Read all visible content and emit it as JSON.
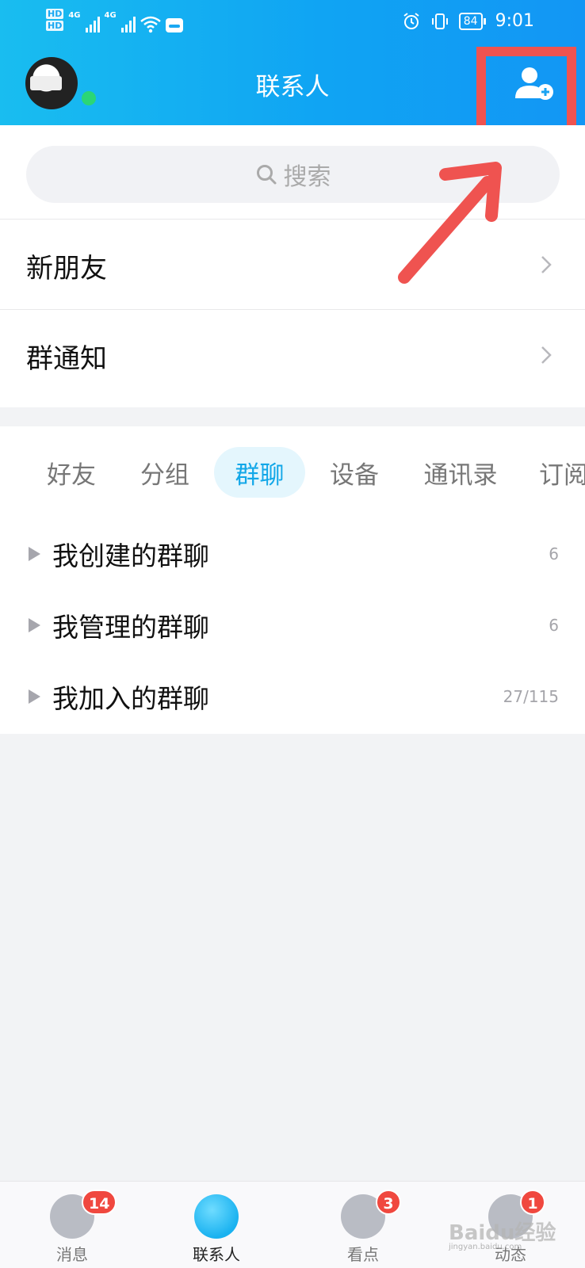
{
  "status_bar": {
    "hd_labels": [
      "HD",
      "HD"
    ],
    "network_labels": [
      "4G",
      "4G"
    ],
    "battery": "84",
    "time": "9:01"
  },
  "header": {
    "title": "联系人"
  },
  "search": {
    "placeholder": "搜索"
  },
  "entries": [
    {
      "label": "新朋友"
    },
    {
      "label": "群通知"
    }
  ],
  "tabs": [
    {
      "label": "好友"
    },
    {
      "label": "分组"
    },
    {
      "label": "群聊",
      "active": true
    },
    {
      "label": "设备"
    },
    {
      "label": "通讯录"
    },
    {
      "label": "订阅"
    }
  ],
  "groups": [
    {
      "name": "我创建的群聊",
      "count": "6"
    },
    {
      "name": "我管理的群聊",
      "count": "6"
    },
    {
      "name": "我加入的群聊",
      "count": "27/115"
    }
  ],
  "bottom_nav": [
    {
      "label": "消息",
      "badge": "14",
      "icon": "message-icon"
    },
    {
      "label": "联系人",
      "badge": "",
      "icon": "contacts-icon",
      "active": true
    },
    {
      "label": "看点",
      "badge": "3",
      "icon": "eye-icon"
    },
    {
      "label": "动态",
      "badge": "1",
      "icon": "star-icon"
    }
  ],
  "watermark": {
    "text": "Baidu经验",
    "sub": "jingyan.baidu.com"
  },
  "colors": {
    "header_start": "#19bdf0",
    "header_end": "#1296f4",
    "accent": "#12a7e8",
    "highlight": "#ef5350",
    "badge": "#f0483f",
    "online": "#2bd676"
  }
}
